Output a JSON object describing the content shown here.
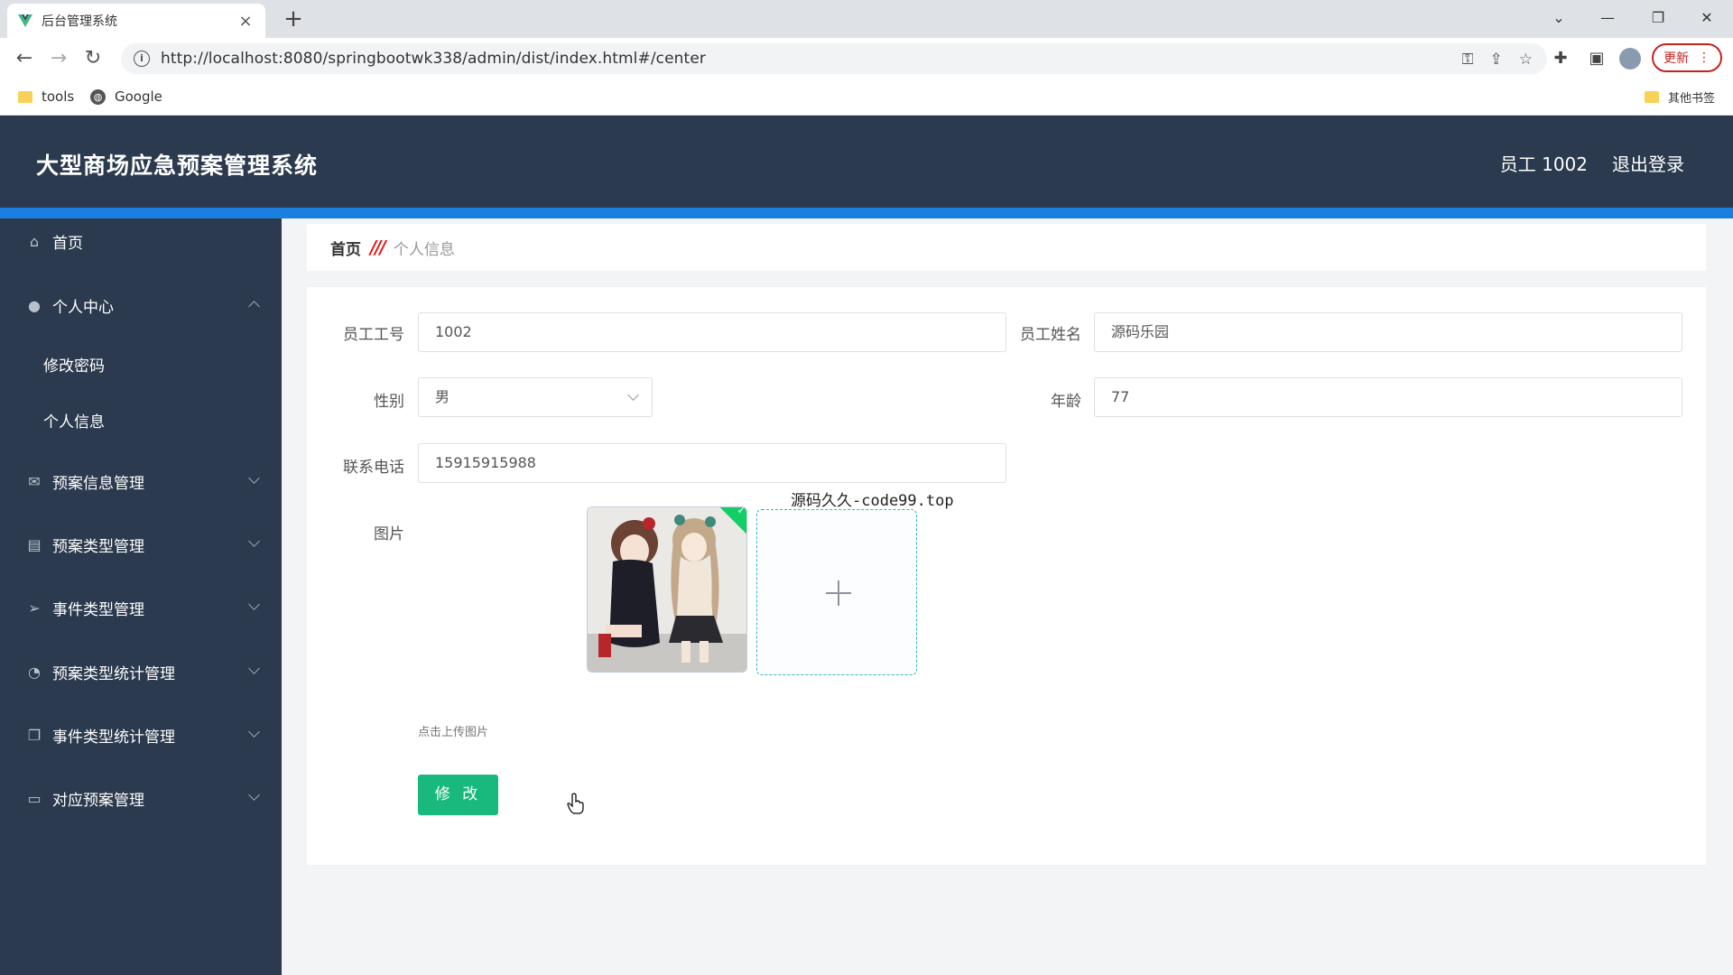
{
  "browser": {
    "tab_title": "后台管理系统",
    "tab_close": "×",
    "new_tab": "+",
    "url": "http://localhost:8080/springbootwk338/admin/dist/index.html#/center",
    "update_label": "更新",
    "bookmarks": [
      {
        "label": "tools",
        "icon": "folder-icon"
      },
      {
        "label": "Google",
        "icon": "globe-icon"
      }
    ],
    "other_bookmarks": "其他书签"
  },
  "header": {
    "title": "大型商场应急预案管理系统",
    "user": "员工 1002",
    "logout": "退出登录"
  },
  "sidebar": {
    "items": [
      {
        "label": "首页",
        "icon": "home-icon"
      },
      {
        "label": "个人中心",
        "icon": "user-icon",
        "expanded": true,
        "children": [
          "修改密码",
          "个人信息"
        ]
      },
      {
        "label": "预案信息管理",
        "icon": "mail-icon"
      },
      {
        "label": "预案类型管理",
        "icon": "clipboard-icon"
      },
      {
        "label": "事件类型管理",
        "icon": "send-icon"
      },
      {
        "label": "预案类型统计管理",
        "icon": "gauge-icon"
      },
      {
        "label": "事件类型统计管理",
        "icon": "copy-icon"
      },
      {
        "label": "对应预案管理",
        "icon": "chat-icon"
      }
    ]
  },
  "breadcrumb": {
    "home": "首页",
    "separator": "///",
    "current": "个人信息"
  },
  "form": {
    "employee_no": {
      "label": "员工工号",
      "value": "1002"
    },
    "employee_name": {
      "label": "员工姓名",
      "value": "源码乐园"
    },
    "gender": {
      "label": "性别",
      "value": "男"
    },
    "age": {
      "label": "年龄",
      "value": "77"
    },
    "phone": {
      "label": "联系电话",
      "value": "15915915988"
    },
    "image": {
      "label": "图片",
      "tip": "点击上传图片"
    },
    "submit": "修 改"
  },
  "overlay_text": "源码久久-code99.top",
  "colors": {
    "header_bg": "#2b3a4e",
    "accent": "#1a7fe0",
    "submit_bg": "#19b97e",
    "success": "#13ce66"
  }
}
